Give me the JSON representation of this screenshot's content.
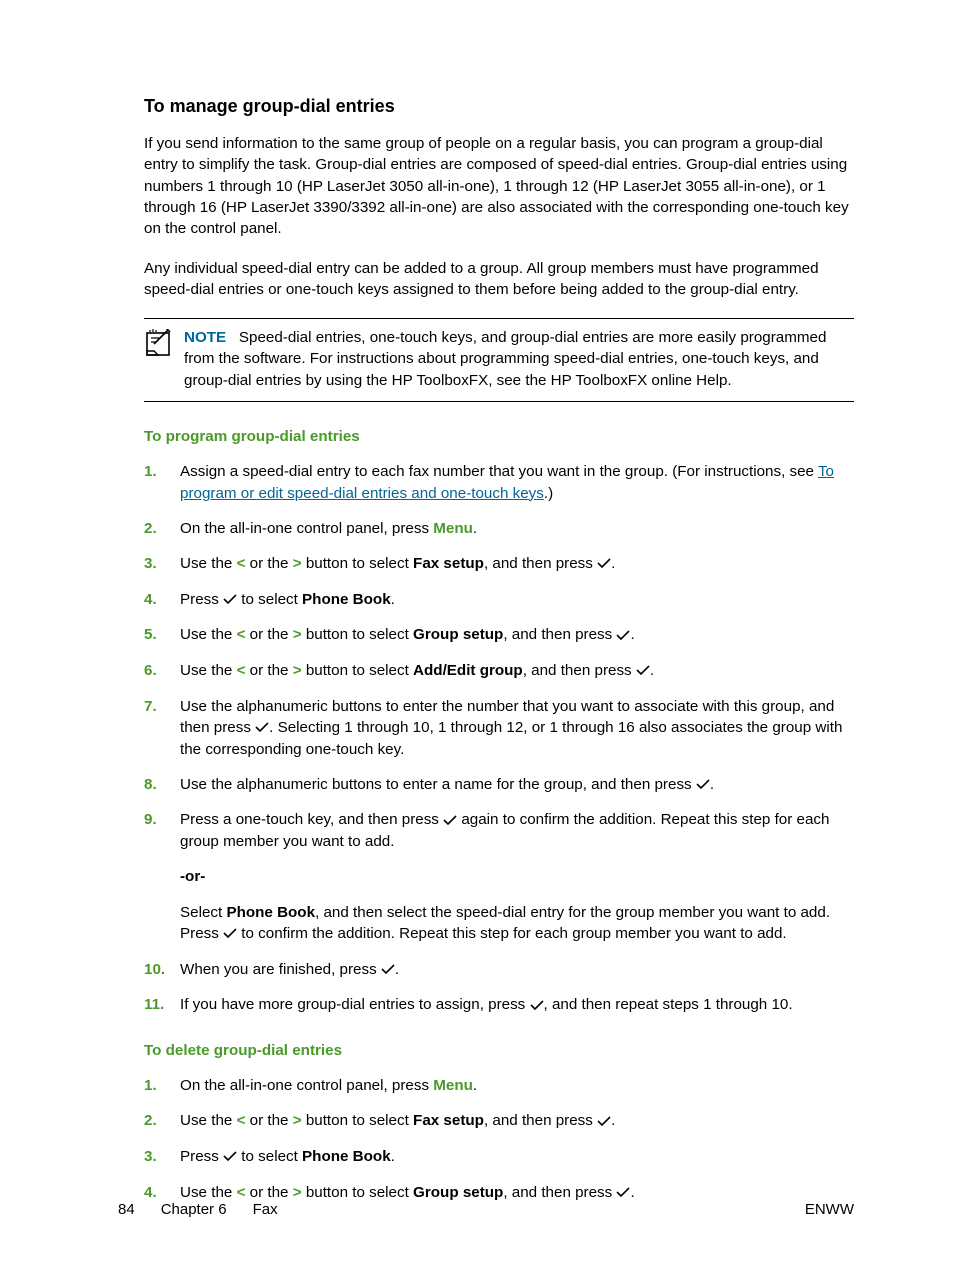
{
  "heading": "To manage group-dial entries",
  "intro1": "If you send information to the same group of people on a regular basis, you can program a group-dial entry to simplify the task. Group-dial entries are composed of speed-dial entries. Group-dial entries using numbers 1 through 10 (HP LaserJet 3050 all-in-one), 1 through 12 (HP LaserJet 3055 all-in-one), or 1 through 16 (HP LaserJet 3390/3392 all-in-one) are also associated with the corresponding one-touch key on the control panel.",
  "intro2": "Any individual speed-dial entry can be added to a group. All group members must have programmed speed-dial entries or one-touch keys assigned to them before being added to the group-dial entry.",
  "note_label": "NOTE",
  "note_text": "Speed-dial entries, one-touch keys, and group-dial entries are more easily programmed from the software. For instructions about programming speed-dial entries, one-touch keys, and group-dial entries by using the HP ToolboxFX, see the HP ToolboxFX online Help.",
  "sub1": "To program group-dial entries",
  "s1_pre": "Assign a speed-dial entry to each fax number that you want in the group. (For instructions, see ",
  "s1_link": "To program or edit speed-dial entries and one-touch keys",
  "s1_post": ".)",
  "s2_a": "On the all-in-one control panel, press ",
  "menu": "Menu",
  "use_the": "Use the ",
  "lt": "<",
  "or_the": " or the ",
  "gt": ">",
  "btn_select": " button to select ",
  "faxsetup": "Fax setup",
  "then_press": ", and then press ",
  "period": ".",
  "press": "Press ",
  "to_select": " to select ",
  "phonebook": "Phone Book",
  "groupsetup": "Group setup",
  "addedit": "Add/Edit group",
  "s7a": "Use the alphanumeric buttons to enter the number that you want to associate with this group, and then press ",
  "s7b": ". Selecting 1 through 10, 1 through 12, or 1 through 16 also associates the group with the corresponding one-touch key.",
  "s8a": "Use the alphanumeric buttons to enter a name for the group, and then press ",
  "s9a": "Press a one-touch key, and then press ",
  "s9b": " again to confirm the addition. Repeat this step for each group member you want to add.",
  "or": "-or-",
  "s9c_a": "Select ",
  "s9c_b": ", and then select the speed-dial entry for the group member you want to add. Press ",
  "s9c_c": " to confirm the addition. Repeat this step for each group member you want to add.",
  "s10a": "When you are finished, press ",
  "s11a": "If you have more group-dial entries to assign, press ",
  "s11b": ", and then repeat steps 1 through 10.",
  "sub2": "To delete group-dial entries",
  "footer_page": "84",
  "footer_chapter": "Chapter 6",
  "footer_section": "Fax",
  "footer_right": "ENWW"
}
